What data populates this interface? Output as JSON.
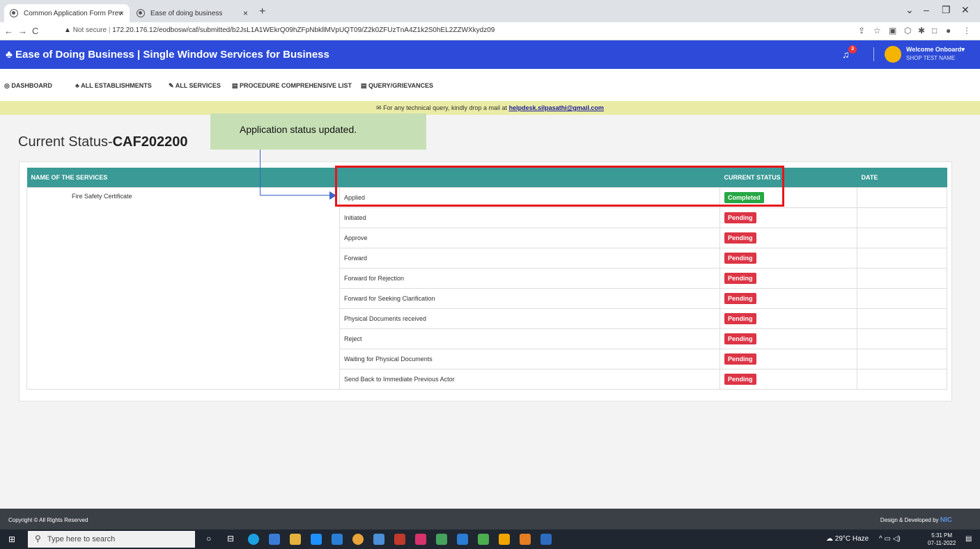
{
  "browser": {
    "tabs": [
      {
        "label": "Common Application Form Prev",
        "close": "×"
      },
      {
        "label": "Ease of doing business",
        "close": "×"
      }
    ],
    "new_tab": "+",
    "url_warning": "Not secure",
    "url": "172.20.176.12/eodbosw/caf/submitted/b2JsL1A1WEkrQ09hZFpNbkllMVpUQT09/Z2k0ZFUzTnA4Z1k2S0hEL2ZZWXkydz09"
  },
  "header": {
    "title": "Ease of Doing Business | Single Window Services for Business",
    "notification_count": "3",
    "welcome": "Welcome Onboard",
    "shop_name": "SHOP TEST NAME",
    "color": "#2d4bd8"
  },
  "menu": {
    "dashboard": "DASHBOARD",
    "establishments": "ALL ESTABLISHMENTS",
    "services": "ALL SERVICES",
    "procedure": "PROCEDURE COMPREHENSIVE LIST",
    "query": "QUERY/GRIEVANCES"
  },
  "notice": {
    "text": "For any technical query, kindly drop a mail at",
    "email": "helpdesk.silpasathi@gmail.com"
  },
  "page": {
    "title_prefix": "Current Status-",
    "caf_id": "CAF202200"
  },
  "tooltip": "Application status updated.",
  "table": {
    "headers": [
      "NAME OF THE SERVICES",
      "",
      "CURRENT STATUS",
      "DATE"
    ],
    "service_name": "Fire Safety Certificate",
    "rows": [
      {
        "step": "Applied",
        "status": "Completed"
      },
      {
        "step": "Initiated",
        "status": "Pending"
      },
      {
        "step": "Approve",
        "status": "Pending"
      },
      {
        "step": "Forward",
        "status": "Pending"
      },
      {
        "step": "Forward for Rejection",
        "status": "Pending"
      },
      {
        "step": "Forward for Seeking Clarification",
        "status": "Pending"
      },
      {
        "step": "Physical Documents received",
        "status": "Pending"
      },
      {
        "step": "Reject",
        "status": "Pending"
      },
      {
        "step": "Waiting for Physical Documents",
        "status": "Pending"
      },
      {
        "step": "Send Back to Immediate Previous Actor",
        "status": "Pending"
      }
    ]
  },
  "footer": {
    "copyright": "Copyright © All Rights Reserved",
    "design": "Design & Developed by",
    "nic": "NIC"
  },
  "taskbar": {
    "search_placeholder": "Type here to search",
    "weather": "29°C Haze",
    "time": "5:31 PM",
    "date": "07-11-2022"
  }
}
